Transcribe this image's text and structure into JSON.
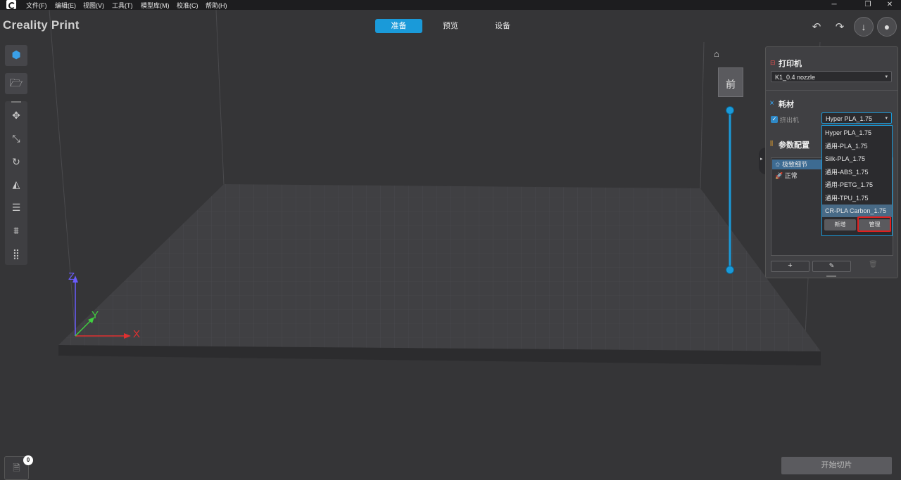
{
  "menubar": {
    "items": [
      "文件(F)",
      "编辑(E)",
      "视图(V)",
      "工具(T)",
      "模型库(M)",
      "校准(C)",
      "帮助(H)"
    ]
  },
  "header": {
    "app_title": "Creality Print",
    "tabs": [
      {
        "label": "准备",
        "active": true
      },
      {
        "label": "预览",
        "active": false
      },
      {
        "label": "设备",
        "active": false
      }
    ]
  },
  "printer_panel": {
    "printer_title": "打印机",
    "printer_value": "K1_0.4 nozzle",
    "material_title": "耗材",
    "extruder_label": "挤出机",
    "extruder_checked": true,
    "material_value": "Hyper PLA_1.75",
    "params_title": "参数配置",
    "params": [
      {
        "label": "极致细节",
        "selected": true
      },
      {
        "label": "正常",
        "selected": false
      }
    ]
  },
  "material_dropdown": {
    "options": [
      "Hyper PLA_1.75",
      "通用-PLA_1.75",
      "Silk-PLA_1.75",
      "通用-ABS_1.75",
      "通用-PETG_1.75",
      "通用-TPU_1.75",
      "CR-PLA Carbon_1.75"
    ],
    "selected_index": 6,
    "add_label": "新增",
    "manage_label": "管理"
  },
  "slice_button_label": "开始切片",
  "log_badge_count": "0",
  "view_cube_label": "前",
  "axes": {
    "x": "X",
    "y": "Y",
    "z": "Z"
  },
  "colors": {
    "accent": "#1a9ad9",
    "highlight": "#e02020",
    "x_axis": "#e03030",
    "y_axis": "#40d040",
    "z_axis": "#6a5cff"
  }
}
